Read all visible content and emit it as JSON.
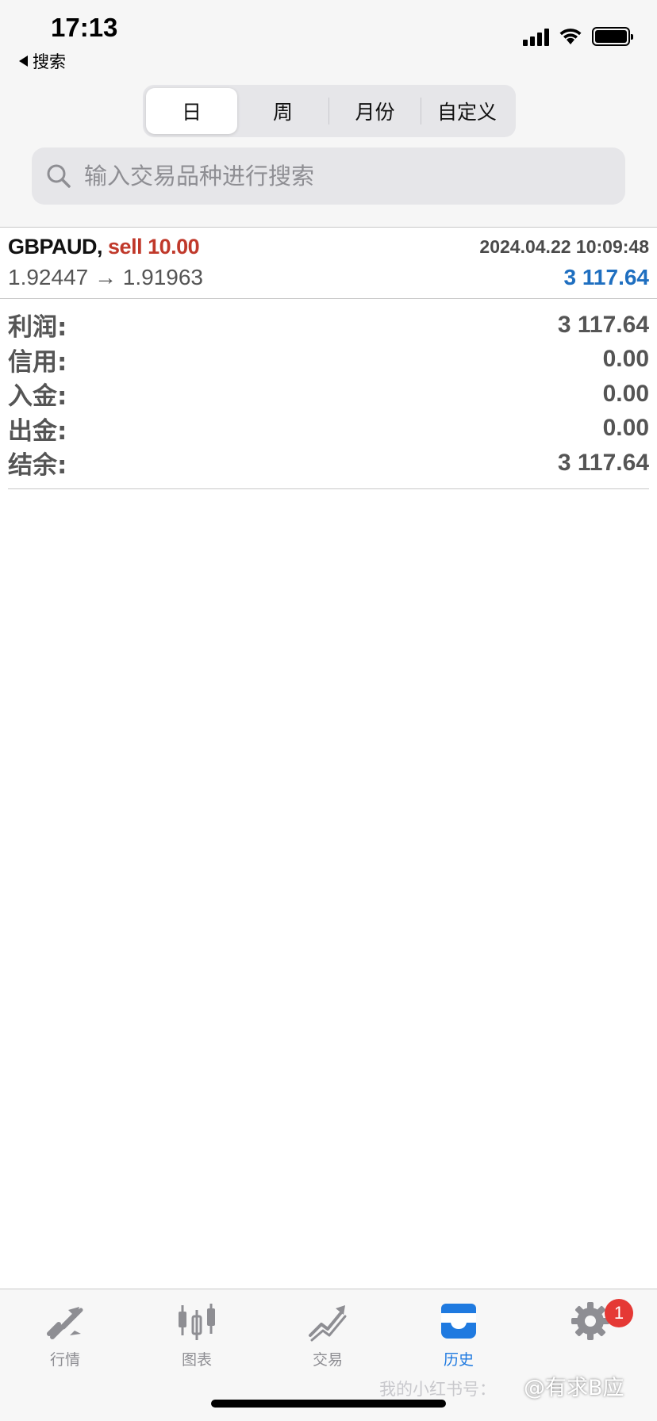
{
  "status_bar": {
    "time": "17:13",
    "back_label": "搜索"
  },
  "period_tabs": [
    {
      "label": "日",
      "active": true
    },
    {
      "label": "周",
      "active": false
    },
    {
      "label": "月份",
      "active": false
    },
    {
      "label": "自定义",
      "active": false
    }
  ],
  "search": {
    "placeholder": "输入交易品种进行搜索",
    "value": ""
  },
  "deal": {
    "symbol": "GBPAUD,",
    "side": "sell 10.00",
    "datetime": "2024.04.22 10:09:48",
    "prices": "1.92447 → 1.91963",
    "profit": "3 117.64"
  },
  "summary": [
    {
      "label": "利润:",
      "value": "3 117.64"
    },
    {
      "label": "信用:",
      "value": "0.00"
    },
    {
      "label": "入金:",
      "value": "0.00"
    },
    {
      "label": "出金:",
      "value": "0.00"
    },
    {
      "label": "结余:",
      "value": "3 117.64"
    }
  ],
  "tabbar": {
    "items": [
      {
        "label": "行情",
        "icon": "quotes-icon",
        "active": false
      },
      {
        "label": "图表",
        "icon": "chart-icon",
        "active": false
      },
      {
        "label": "交易",
        "icon": "trade-icon",
        "active": false
      },
      {
        "label": "历史",
        "icon": "history-icon",
        "active": true
      },
      {
        "label": "设置",
        "icon": "gear-icon",
        "active": false,
        "badge": "1"
      }
    ]
  },
  "watermark": {
    "left_text": "我的小红书号：",
    "right_text": "@有求B应"
  },
  "colors": {
    "sell": "#c0392b",
    "profit": "#1f6fc0",
    "active_tab": "#1f7ae0",
    "badge": "#e53935"
  }
}
